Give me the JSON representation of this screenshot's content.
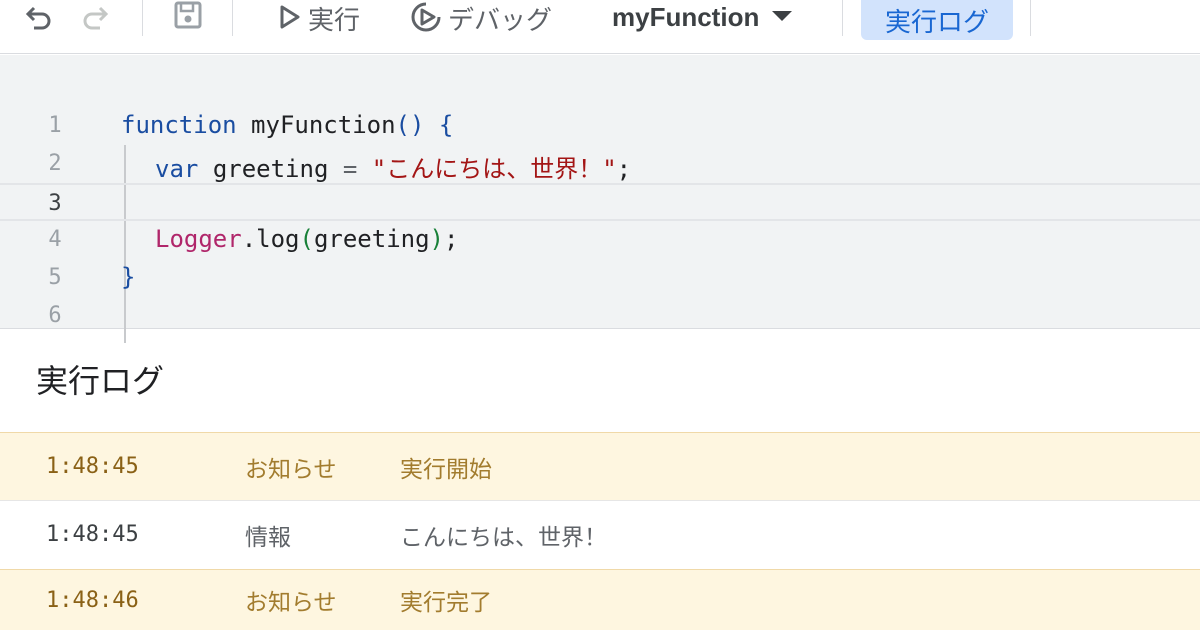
{
  "toolbar": {
    "undo_icon": "undo-icon",
    "redo_icon": "redo-icon",
    "save_icon": "save-icon",
    "run_label": "実行",
    "debug_label": "デバッグ",
    "function_select": "myFunction",
    "log_button": "実行ログ"
  },
  "editor": {
    "lines": [
      {
        "number": "1"
      },
      {
        "number": "2"
      },
      {
        "number": "3"
      },
      {
        "number": "4"
      },
      {
        "number": "5"
      },
      {
        "number": "6"
      }
    ],
    "tokens": {
      "function_kw": "function",
      "function_name": "myFunction",
      "open_sig": "() {",
      "var_kw": "var",
      "var_name": "greeting",
      "assign": " = ",
      "string": "\"こんにちは、世界！\"",
      "semicolon": ";",
      "logger": "Logger",
      "dot_log": ".log",
      "open_paren": "(",
      "arg": "greeting",
      "close_paren": ")",
      "semicolon2": ";",
      "close_brace": "}"
    }
  },
  "log": {
    "title": "実行ログ",
    "rows": [
      {
        "time": "1:48:45",
        "level": "お知らせ",
        "message": "実行開始"
      },
      {
        "time": "1:48:45",
        "level": "情報",
        "message": "こんにちは、世界！"
      },
      {
        "time": "1:48:46",
        "level": "お知らせ",
        "message": "実行完了"
      }
    ]
  },
  "colors": {
    "accent": "#1967d2",
    "log_button_bg": "#d2e3fc",
    "notice_bg": "#fef6e0",
    "editor_bg": "#f1f3f4"
  }
}
